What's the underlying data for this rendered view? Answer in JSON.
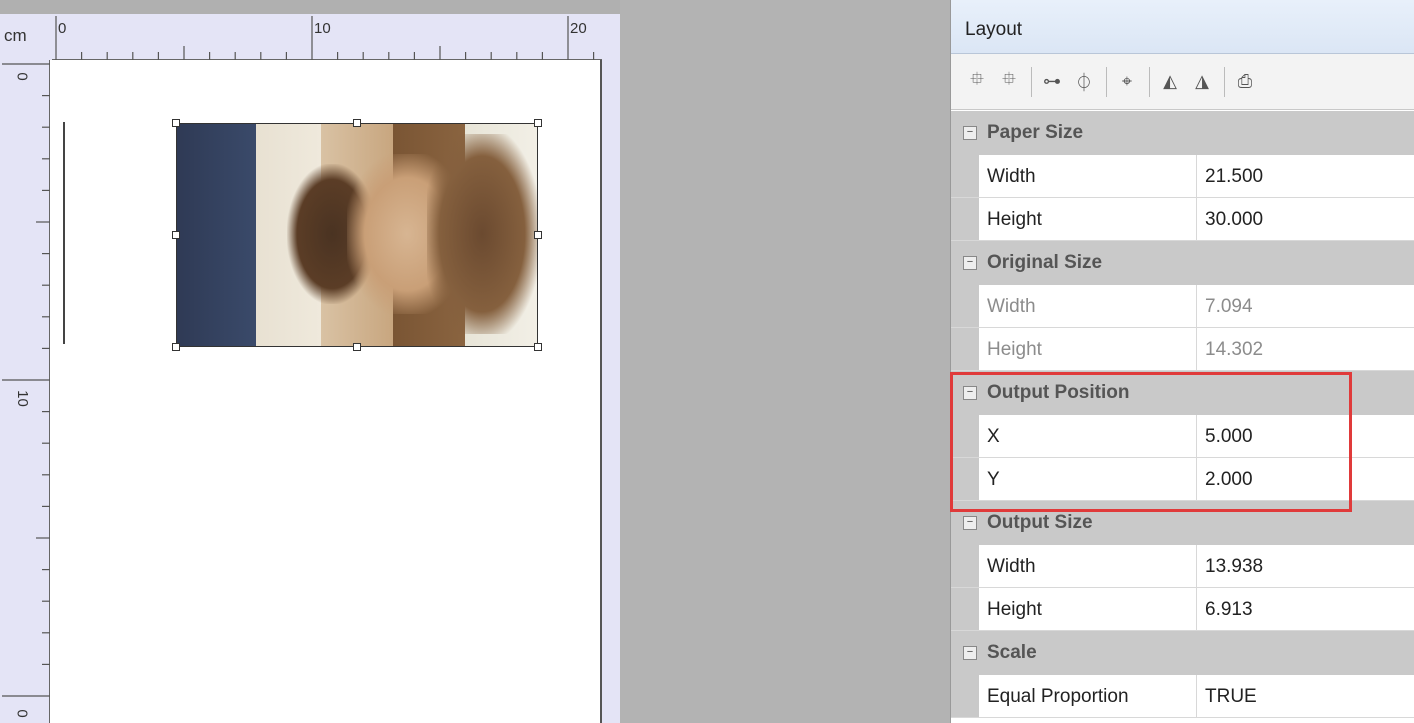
{
  "ruler": {
    "unit": "cm",
    "h_labels": [
      "0",
      "10",
      "20"
    ],
    "v_labels": [
      "0",
      "10",
      "0"
    ]
  },
  "panel": {
    "title": "Layout",
    "toolbar_icons": [
      "align-top-left-icon",
      "align-top-right-icon",
      "center-horizontal-icon",
      "center-vertical-icon",
      "center-both-icon",
      "flip-horizontal-icon",
      "mirror-icon",
      "print-icon"
    ],
    "groups": [
      {
        "name": "Paper Size",
        "rows": [
          {
            "name": "Width",
            "value": "21.500",
            "disabled": false
          },
          {
            "name": "Height",
            "value": "30.000",
            "disabled": false
          }
        ]
      },
      {
        "name": "Original Size",
        "rows": [
          {
            "name": "Width",
            "value": "7.094",
            "disabled": true
          },
          {
            "name": "Height",
            "value": "14.302",
            "disabled": true
          }
        ]
      },
      {
        "name": "Output Position",
        "rows": [
          {
            "name": "X",
            "value": "5.000",
            "disabled": false
          },
          {
            "name": "Y",
            "value": "2.000",
            "disabled": false
          }
        ]
      },
      {
        "name": "Output Size",
        "rows": [
          {
            "name": "Width",
            "value": "13.938",
            "disabled": false
          },
          {
            "name": "Height",
            "value": "6.913",
            "disabled": false
          }
        ]
      },
      {
        "name": "Scale",
        "rows": [
          {
            "name": "Equal Proportion",
            "value": "TRUE",
            "disabled": false
          }
        ]
      }
    ]
  },
  "colors": {
    "highlight": "#e03a3a",
    "group_bg": "#c9c9c9",
    "ruler_bg": "#e4e4f6"
  }
}
